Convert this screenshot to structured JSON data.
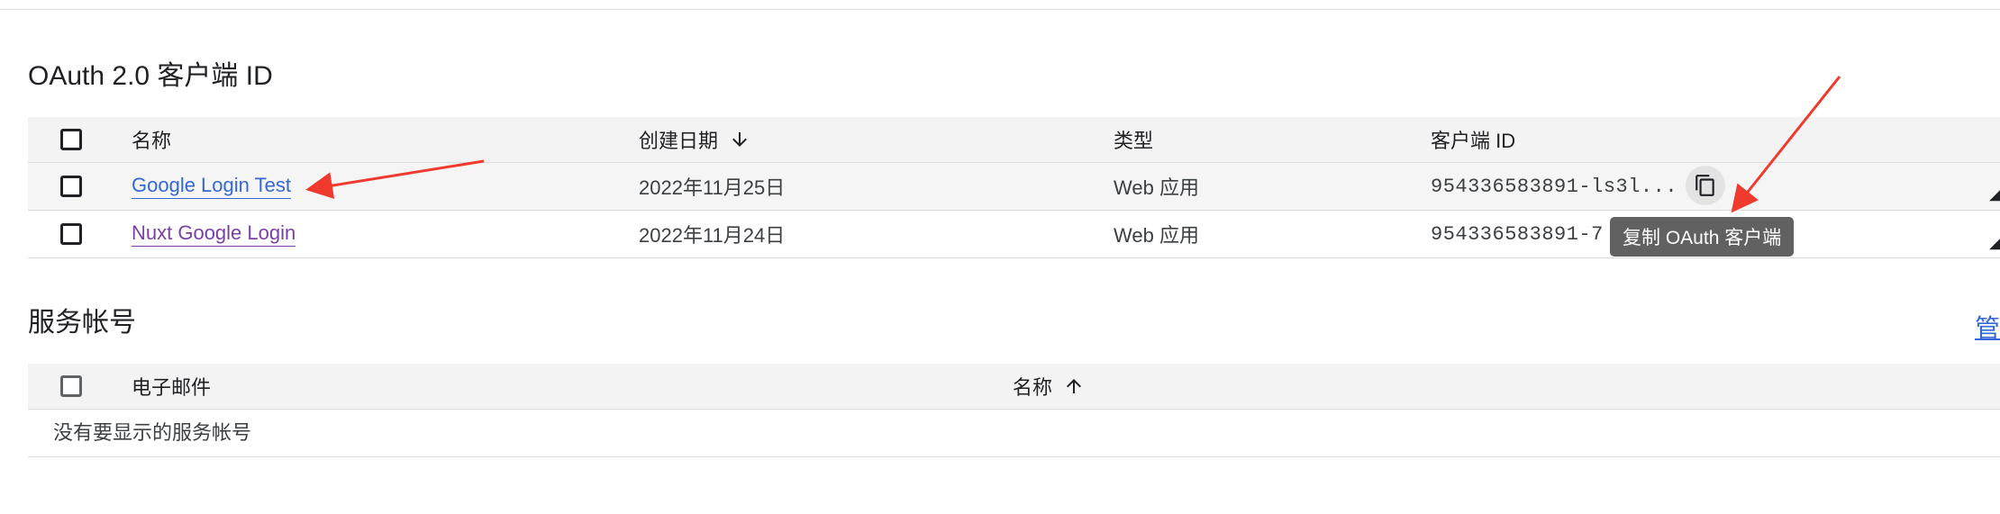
{
  "oauth_section": {
    "title": "OAuth 2.0 客户端 ID",
    "columns": {
      "name": "名称",
      "created": "创建日期",
      "type": "类型",
      "client_id": "客户端 ID"
    },
    "rows": [
      {
        "name": "Google Login Test",
        "created": "2022年11月25日",
        "type": "Web 应用",
        "client_id": "954336583891-ls3l..."
      },
      {
        "name": "Nuxt Google Login",
        "created": "2022年11月24日",
        "type": "Web 应用",
        "client_id": "954336583891-7"
      }
    ],
    "copy_tooltip": "复制 OAuth 客户端"
  },
  "service_accounts_section": {
    "title": "服务帐号",
    "manage_link_partial": "管",
    "columns": {
      "email": "电子邮件",
      "name": "名称"
    },
    "empty_message": "没有要显示的服务帐号"
  },
  "colors": {
    "link": "#3367d6",
    "visited_link": "#7b3fa6",
    "header_bg": "#f3f3f3",
    "tooltip_bg": "#616161",
    "annotation": "#f03a2e"
  },
  "icons": {
    "created_sort": "arrow-down-icon",
    "name_sort": "arrow-up-icon",
    "copy": "copy-icon"
  }
}
